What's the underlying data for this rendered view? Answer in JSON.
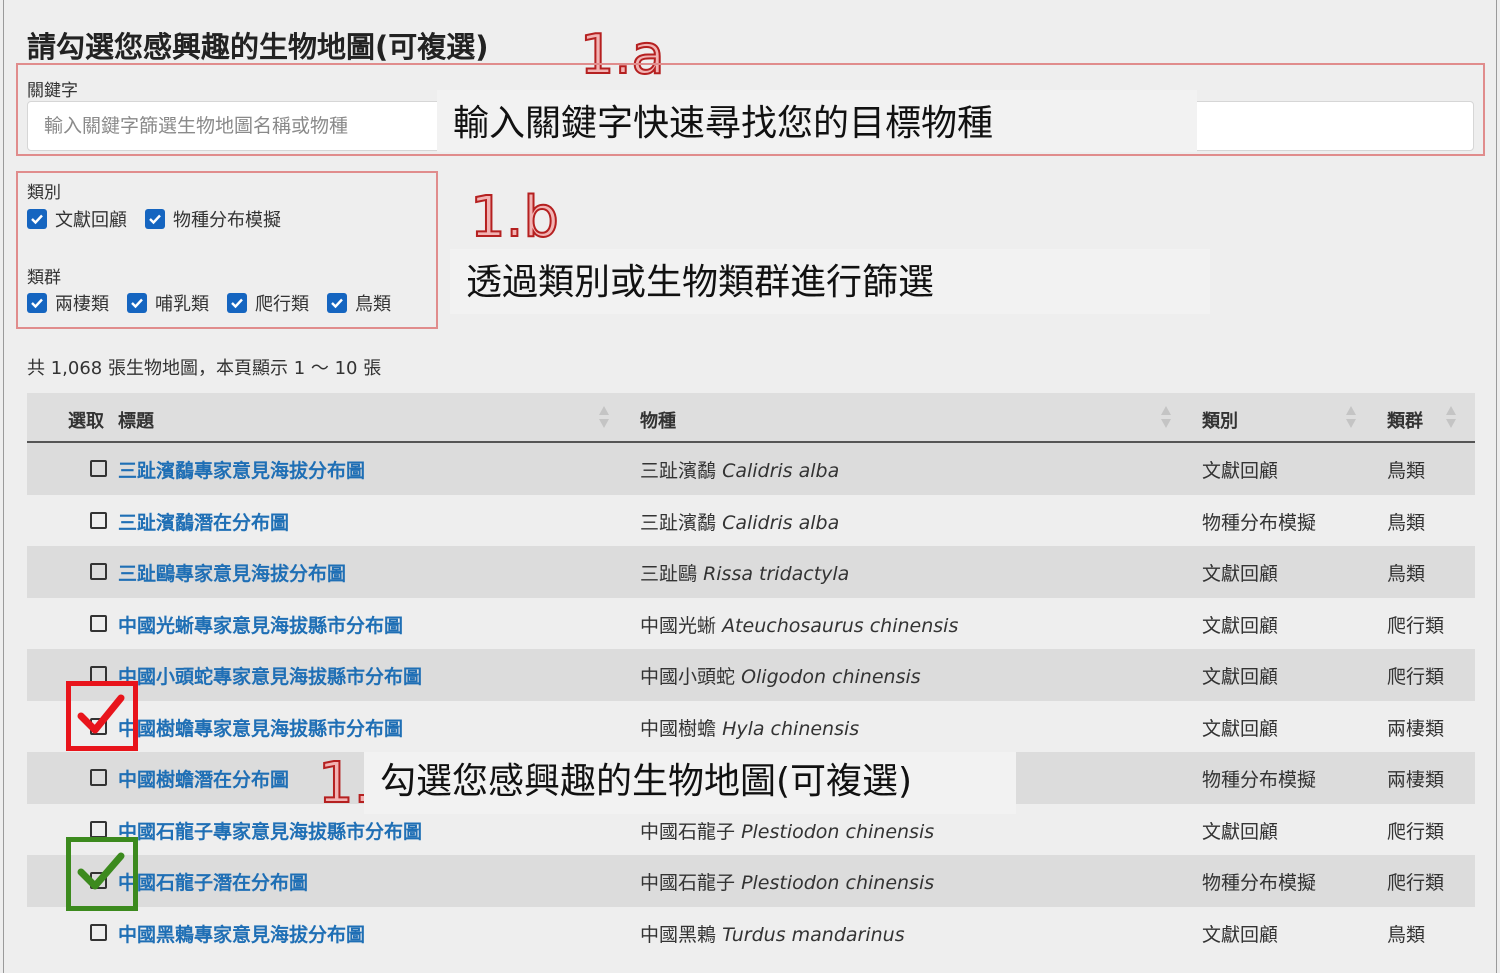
{
  "page_title": "請勾選您感興趣的生物地圖(可複選)",
  "annotations": {
    "a": "1.a",
    "b": "1.b",
    "c": "1.",
    "keyword_tip": "輸入關鍵字快速尋找您的目標物種",
    "filter_tip": "透過類別或生物類群進行篩選",
    "select_tip": "勾選您感興趣的生物地圖(可複選)"
  },
  "keyword": {
    "label": "關鍵字",
    "placeholder": "輸入關鍵字篩選生物地圖名稱或物種",
    "value": ""
  },
  "filters": {
    "category_label": "類別",
    "categories": [
      {
        "label": "文獻回顧",
        "checked": true
      },
      {
        "label": "物種分布模擬",
        "checked": true
      }
    ],
    "group_label": "類群",
    "groups": [
      {
        "label": "兩棲類",
        "checked": true
      },
      {
        "label": "哺乳類",
        "checked": true
      },
      {
        "label": "爬行類",
        "checked": true
      },
      {
        "label": "鳥類",
        "checked": true
      }
    ]
  },
  "summary": "共 1,068 張生物地圖，本頁顯示 1 ～ 10 張",
  "table": {
    "headers": {
      "select": "選取",
      "title": "標題",
      "species": "物種",
      "category": "類別",
      "group": "類群"
    },
    "rows": [
      {
        "title": "三趾濱鷸專家意見海拔分布圖",
        "species_zh": "三趾濱鷸",
        "species_sci": "Calidris alba",
        "category": "文獻回顧",
        "group": "鳥類"
      },
      {
        "title": "三趾濱鷸潛在分布圖",
        "species_zh": "三趾濱鷸",
        "species_sci": "Calidris alba",
        "category": "物種分布模擬",
        "group": "鳥類"
      },
      {
        "title": "三趾鷗專家意見海拔分布圖",
        "species_zh": "三趾鷗",
        "species_sci": "Rissa tridactyla",
        "category": "文獻回顧",
        "group": "鳥類"
      },
      {
        "title": "中國光蜥專家意見海拔縣市分布圖",
        "species_zh": "中國光蜥",
        "species_sci": "Ateuchosaurus chinensis",
        "category": "文獻回顧",
        "group": "爬行類"
      },
      {
        "title": "中國小頭蛇專家意見海拔縣市分布圖",
        "species_zh": "中國小頭蛇",
        "species_sci": "Oligodon chinensis",
        "category": "文獻回顧",
        "group": "爬行類"
      },
      {
        "title": "中國樹蟾專家意見海拔縣市分布圖",
        "species_zh": "中國樹蟾",
        "species_sci": "Hyla chinensis",
        "category": "文獻回顧",
        "group": "兩棲類"
      },
      {
        "title": "中國樹蟾潛在分布圖",
        "species_zh": "",
        "species_sci": "",
        "category": "物種分布模擬",
        "group": "兩棲類"
      },
      {
        "title": "中國石龍子專家意見海拔縣市分布圖",
        "species_zh": "中國石龍子",
        "species_sci": "Plestiodon chinensis",
        "category": "文獻回顧",
        "group": "爬行類"
      },
      {
        "title": "中國石龍子潛在分布圖",
        "species_zh": "中國石龍子",
        "species_sci": "Plestiodon chinensis",
        "category": "物種分布模擬",
        "group": "爬行類"
      },
      {
        "title": "中國黑鶇專家意見海拔分布圖",
        "species_zh": "中國黑鶇",
        "species_sci": "Turdus mandarinus",
        "category": "文獻回顧",
        "group": "鳥類"
      }
    ]
  },
  "colors": {
    "link": "#1f6fb5",
    "checkbox": "#1565c0",
    "mark_red": "#e8141b",
    "mark_green": "#3c8a1e",
    "annotation": "#b52020"
  }
}
